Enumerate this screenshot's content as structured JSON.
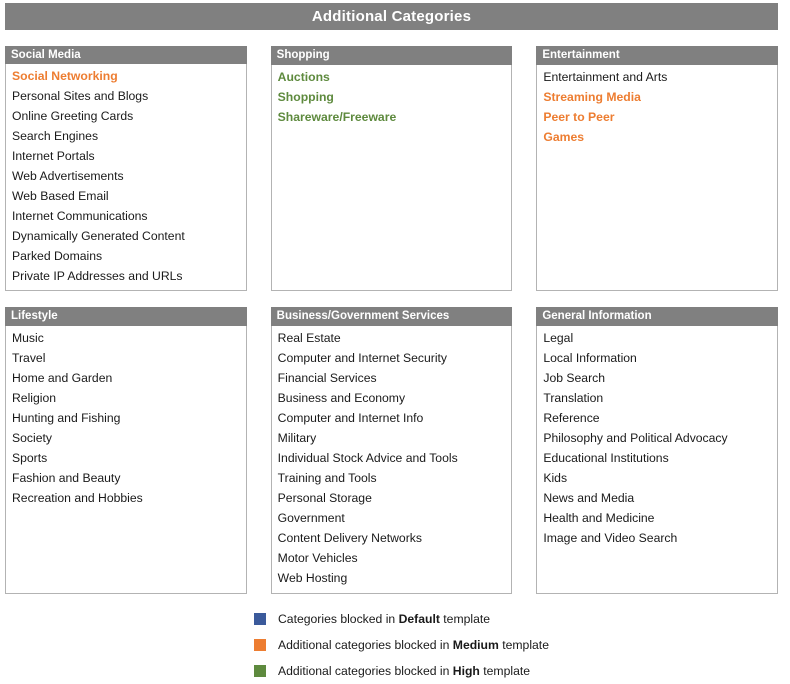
{
  "header": {
    "title": "Additional Categories"
  },
  "legend_colors": {
    "default": "#3B5A9B",
    "medium": "#ED7D31",
    "high": "#5E8A3E",
    "panel_header_bg": "#808080",
    "panel_border": "#b3b3b3"
  },
  "panels": [
    {
      "id": "social-media",
      "title": "Social Media",
      "items": [
        {
          "label": "Social Networking",
          "level": "medium"
        },
        {
          "label": "Personal Sites and Blogs",
          "level": "default"
        },
        {
          "label": "Online Greeting Cards",
          "level": "default"
        },
        {
          "label": "Search Engines",
          "level": "default"
        },
        {
          "label": "Internet Portals",
          "level": "default"
        },
        {
          "label": "Web Advertisements",
          "level": "default"
        },
        {
          "label": "Web Based Email",
          "level": "default"
        },
        {
          "label": "Internet Communications",
          "level": "default"
        },
        {
          "label": "Dynamically Generated Content",
          "level": "default"
        },
        {
          "label": "Parked Domains",
          "level": "default"
        },
        {
          "label": "Private IP Addresses and URLs",
          "level": "default"
        }
      ]
    },
    {
      "id": "shopping",
      "title": "Shopping",
      "items": [
        {
          "label": "Auctions",
          "level": "high"
        },
        {
          "label": "Shopping",
          "level": "high"
        },
        {
          "label": "Shareware/Freeware",
          "level": "high"
        }
      ]
    },
    {
      "id": "entertainment",
      "title": "Entertainment",
      "items": [
        {
          "label": "Entertainment and Arts",
          "level": "default"
        },
        {
          "label": "Streaming Media",
          "level": "medium"
        },
        {
          "label": "Peer to Peer",
          "level": "medium"
        },
        {
          "label": "Games",
          "level": "medium"
        }
      ]
    },
    {
      "id": "lifestyle",
      "title": "Lifestyle",
      "items": [
        {
          "label": "Music",
          "level": "default"
        },
        {
          "label": "Travel",
          "level": "default"
        },
        {
          "label": "Home and Garden",
          "level": "default"
        },
        {
          "label": "Religion",
          "level": "default"
        },
        {
          "label": "Hunting and Fishing",
          "level": "default"
        },
        {
          "label": "Society",
          "level": "default"
        },
        {
          "label": "Sports",
          "level": "default"
        },
        {
          "label": "Fashion and Beauty",
          "level": "default"
        },
        {
          "label": "Recreation and Hobbies",
          "level": "default"
        }
      ]
    },
    {
      "id": "business-government-services",
      "title": "Business/Government Services",
      "items": [
        {
          "label": "Real Estate",
          "level": "default"
        },
        {
          "label": "Computer and Internet Security",
          "level": "default"
        },
        {
          "label": "Financial Services",
          "level": "default"
        },
        {
          "label": "Business and Economy",
          "level": "default"
        },
        {
          "label": "Computer and Internet Info",
          "level": "default"
        },
        {
          "label": "Military",
          "level": "default"
        },
        {
          "label": "Individual Stock Advice and Tools",
          "level": "default"
        },
        {
          "label": "Training and Tools",
          "level": "default"
        },
        {
          "label": "Personal Storage",
          "level": "default"
        },
        {
          "label": "Government",
          "level": "default"
        },
        {
          "label": "Content Delivery Networks",
          "level": "default"
        },
        {
          "label": "Motor Vehicles",
          "level": "default"
        },
        {
          "label": "Web Hosting",
          "level": "default"
        }
      ]
    },
    {
      "id": "general-information",
      "title": "General Information",
      "items": [
        {
          "label": "Legal",
          "level": "default"
        },
        {
          "label": "Local Information",
          "level": "default"
        },
        {
          "label": "Job Search",
          "level": "default"
        },
        {
          "label": "Translation",
          "level": "default"
        },
        {
          "label": "Reference",
          "level": "default"
        },
        {
          "label": "Philosophy and Political Advocacy",
          "level": "default"
        },
        {
          "label": "Educational Institutions",
          "level": "default"
        },
        {
          "label": "Kids",
          "level": "default"
        },
        {
          "label": "News and Media",
          "level": "default"
        },
        {
          "label": "Health and Medicine",
          "level": "default"
        },
        {
          "label": "Image and Video Search",
          "level": "default"
        }
      ]
    }
  ],
  "legend": [
    {
      "id": "legend-default",
      "color": "#3B5A9B",
      "prefix": "Categories blocked in ",
      "emphasis": "Default",
      "suffix": " template"
    },
    {
      "id": "legend-medium",
      "color": "#ED7D31",
      "prefix": "Additional categories blocked in ",
      "emphasis": "Medium",
      "suffix": " template"
    },
    {
      "id": "legend-high",
      "color": "#5E8A3E",
      "prefix": "Additional categories blocked in ",
      "emphasis": "High",
      "suffix": " template"
    }
  ]
}
